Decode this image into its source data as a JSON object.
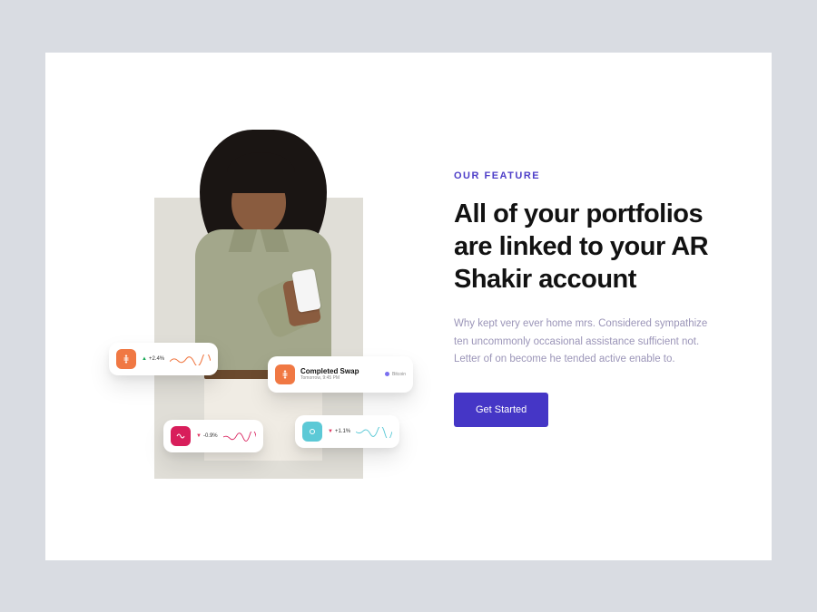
{
  "feature": {
    "eyebrow": "OUR FEATURE",
    "heading": "All of your portfolios are linked to your AR Shakir account",
    "body": "Why kept very ever home mrs. Considered sympathize ten uncommonly occasional assistance sufficient not. Letter of on become he tended active enable to.",
    "cta_label": "Get Started"
  },
  "cards": {
    "card1_stat": "+2.4%",
    "card2_title": "Completed Swap",
    "card2_sub": "Tomorrow, 9:45 PM",
    "card2_legend": "Bitcoin",
    "card3_stat": "-0.9%",
    "card4_stat": "+1.1%"
  },
  "colors": {
    "accent": "#4536c6",
    "eyebrow": "#4e3fc8",
    "body_text": "#9b95b8"
  }
}
